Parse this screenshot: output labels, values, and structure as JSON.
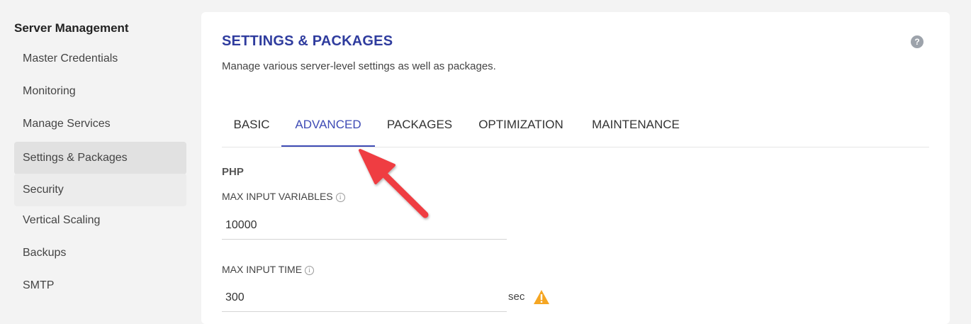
{
  "sidebar": {
    "title": "Server Management",
    "items": [
      {
        "label": "Master Credentials"
      },
      {
        "label": "Monitoring"
      },
      {
        "label": "Manage Services"
      },
      {
        "label": "Settings & Packages",
        "active": true
      },
      {
        "label": "Security"
      },
      {
        "label": "Vertical Scaling"
      },
      {
        "label": "Backups"
      },
      {
        "label": "SMTP"
      }
    ]
  },
  "main": {
    "title": "SETTINGS & PACKAGES",
    "subtitle": "Manage various server-level settings as well as packages.",
    "help_icon": "question-circle-icon",
    "help_glyph": "?",
    "tabs": [
      {
        "label": "BASIC"
      },
      {
        "label": "ADVANCED",
        "active": true
      },
      {
        "label": "PACKAGES"
      },
      {
        "label": "OPTIMIZATION"
      },
      {
        "label": "MAINTENANCE"
      }
    ],
    "section": "PHP",
    "fields": [
      {
        "label": "MAX INPUT VARIABLES",
        "value": "10000",
        "info_icon": "info-circle-icon"
      },
      {
        "label": "MAX INPUT TIME",
        "value": "300",
        "unit": "sec",
        "warning_icon": "warning-triangle-icon",
        "info_icon": "info-circle-icon"
      }
    ],
    "info_glyph": "i"
  },
  "colors": {
    "accent": "#3e4bb5",
    "title": "#2f3c9e",
    "annotation_arrow": "#ef3e42",
    "warning": "#f5a623"
  }
}
